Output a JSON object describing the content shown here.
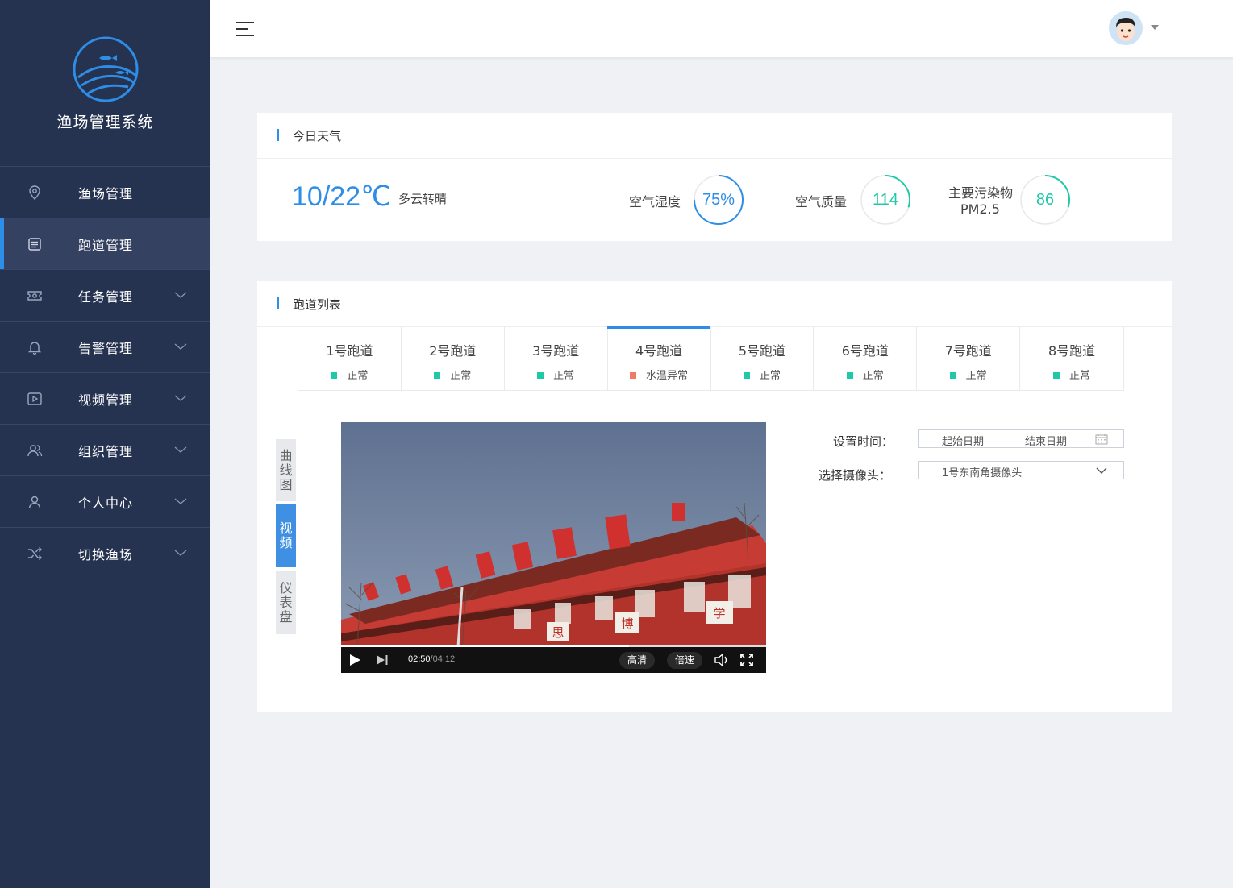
{
  "app": {
    "title": "渔场管理系统"
  },
  "sidebar": {
    "items": [
      {
        "label": "渔场管理",
        "icon": "location-pin-icon",
        "active": false,
        "expandable": false
      },
      {
        "label": "跑道管理",
        "icon": "list-icon",
        "active": true,
        "expandable": false
      },
      {
        "label": "任务管理",
        "icon": "ticket-icon",
        "active": false,
        "expandable": true
      },
      {
        "label": "告警管理",
        "icon": "bell-icon",
        "active": false,
        "expandable": true
      },
      {
        "label": "视频管理",
        "icon": "video-icon",
        "active": false,
        "expandable": true
      },
      {
        "label": "组织管理",
        "icon": "users-icon",
        "active": false,
        "expandable": true
      },
      {
        "label": "个人中心",
        "icon": "user-icon",
        "active": false,
        "expandable": true
      },
      {
        "label": "切换渔场",
        "icon": "shuffle-icon",
        "active": false,
        "expandable": true
      }
    ]
  },
  "weather": {
    "title": "今日天气",
    "temperature": "10/22℃",
    "description": "多云转晴",
    "humidity": {
      "label": "空气湿度",
      "value": "75%",
      "fraction": 0.75,
      "color": "#2e8de6"
    },
    "air_quality": {
      "label": "空气质量",
      "value": "114",
      "fraction": 0.3,
      "color": "#1fc8a6"
    },
    "pollutant": {
      "label": "主要污染物",
      "sub": "PM2.5",
      "value": "86",
      "fraction": 0.3,
      "color": "#1fc8a6"
    }
  },
  "lanes": {
    "title": "跑道列表",
    "tabs": [
      {
        "name": "1号跑道",
        "status": "正常",
        "color": "#1fc8a6",
        "active": false
      },
      {
        "name": "2号跑道",
        "status": "正常",
        "color": "#1fc8a6",
        "active": false
      },
      {
        "name": "3号跑道",
        "status": "正常",
        "color": "#1fc8a6",
        "active": false
      },
      {
        "name": "4号跑道",
        "status": "水温异常",
        "color": "#f07a66",
        "active": true
      },
      {
        "name": "5号跑道",
        "status": "正常",
        "color": "#1fc8a6",
        "active": false
      },
      {
        "name": "6号跑道",
        "status": "正常",
        "color": "#1fc8a6",
        "active": false
      },
      {
        "name": "7号跑道",
        "status": "正常",
        "color": "#1fc8a6",
        "active": false
      },
      {
        "name": "8号跑道",
        "status": "正常",
        "color": "#1fc8a6",
        "active": false
      }
    ],
    "view_tabs": [
      {
        "label": "曲线图",
        "active": false
      },
      {
        "label": "视频",
        "active": true
      },
      {
        "label": "仪表盘",
        "active": false
      }
    ],
    "player": {
      "current": "02:50",
      "duration": "/04:12",
      "quality": "高清",
      "speed": "倍速",
      "progress": 0.677,
      "scene_chars": [
        "思",
        "博",
        "学"
      ]
    },
    "form": {
      "time_label": "设置时间：",
      "start_placeholder": "起始日期",
      "end_placeholder": "结束日期",
      "camera_label": "选择摄像头：",
      "camera_value": "1号东南角摄像头"
    }
  },
  "colors": {
    "sidebar": "#253350",
    "accent": "#2e8de6",
    "ok": "#1fc8a6",
    "warn": "#f07a66"
  }
}
